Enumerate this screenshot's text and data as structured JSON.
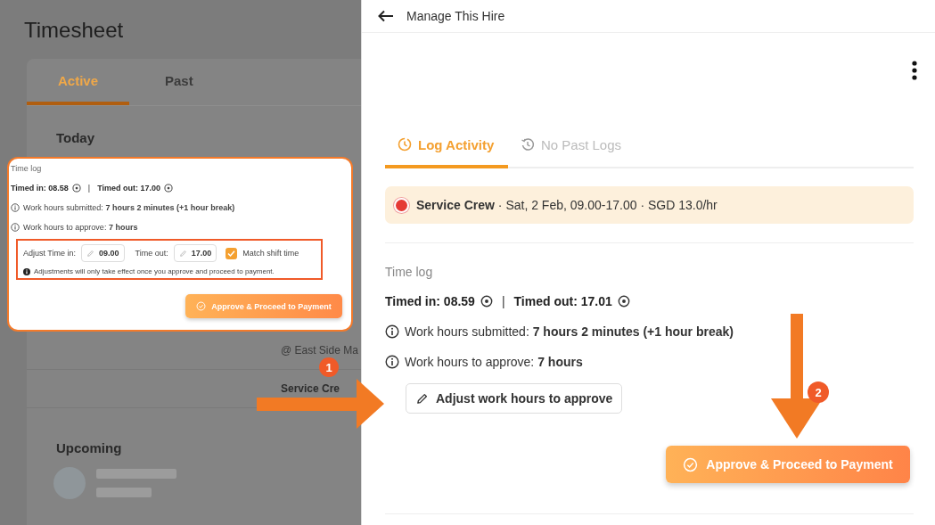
{
  "background_page": {
    "title": "Timesheet",
    "tabs": [
      {
        "label": "Active",
        "selected": true
      },
      {
        "label": "Past",
        "selected": false
      }
    ],
    "section_today": "Today",
    "rows": [
      {
        "text": "@ East Side Ma",
        "kind": "location"
      },
      {
        "text": "Service Cre",
        "kind": "role"
      }
    ],
    "section_upcoming": "Upcoming"
  },
  "callout": {
    "heading": "Time log",
    "timed_in": "Timed in: 08.58",
    "separator": "|",
    "timed_out": "Timed out: 17.00",
    "info_rows": [
      "Work hours submitted: **7 hours 2 minutes (+1 hour break)**",
      "Work hours to approve: **7 hours**"
    ],
    "adjust": {
      "time_in_label": "Adjust Time in:",
      "time_in": "09.00",
      "time_out_label": "Time out:",
      "time_out": "17.00",
      "match_label": "Match shift time",
      "match_checked": true,
      "note": "Adjustments will only take effect once you approve and proceed to payment."
    },
    "approve_button": "Approve & Proceed to Payment"
  },
  "panel": {
    "title": "Manage This Hire",
    "tabs": [
      {
        "label": "Log Activity",
        "selected": true
      },
      {
        "label": "No Past Logs",
        "selected": false
      }
    ],
    "shift": {
      "text": "**Service Crew** · Sat, 2 Feb, 09.00-17.00 · SGD 13.0/hr",
      "color": "#e53935"
    },
    "time_log": {
      "heading": "Time log",
      "timed_in": "Timed in: 08.59",
      "separator": "|",
      "timed_out": "Timed out: 17.01",
      "info_rows": [
        "Work hours submitted: **7 hours 2 minutes (+1 hour break)**",
        "Work hours to approve: **7 hours**"
      ]
    },
    "adjust_button": "Adjust work hours to approve",
    "approve_button": "Approve & Proceed to Payment"
  },
  "annotations": [
    {
      "number": "1",
      "kind": "right"
    },
    {
      "number": "2",
      "kind": "down"
    }
  ]
}
